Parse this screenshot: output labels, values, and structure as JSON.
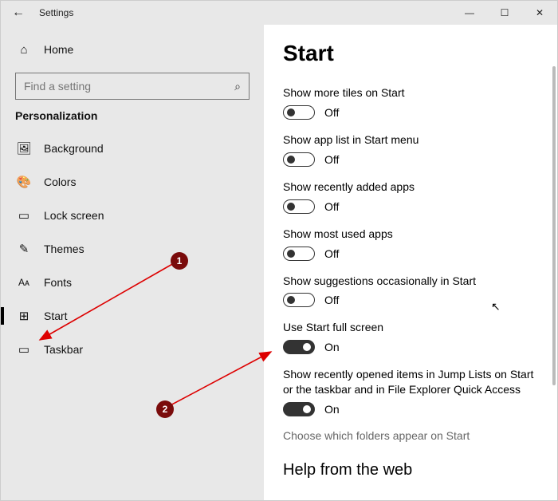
{
  "titlebar": {
    "title": "Settings"
  },
  "sidebar": {
    "home": "Home",
    "search_placeholder": "Find a setting",
    "category": "Personalization",
    "items": [
      {
        "label": "Background"
      },
      {
        "label": "Colors"
      },
      {
        "label": "Lock screen"
      },
      {
        "label": "Themes"
      },
      {
        "label": "Fonts"
      },
      {
        "label": "Start"
      },
      {
        "label": "Taskbar"
      }
    ]
  },
  "main": {
    "heading": "Start",
    "settings": [
      {
        "label": "Show more tiles on Start",
        "state": "Off",
        "on": false
      },
      {
        "label": "Show app list in Start menu",
        "state": "Off",
        "on": false
      },
      {
        "label": "Show recently added apps",
        "state": "Off",
        "on": false
      },
      {
        "label": "Show most used apps",
        "state": "Off",
        "on": false
      },
      {
        "label": "Show suggestions occasionally in Start",
        "state": "Off",
        "on": false
      },
      {
        "label": "Use Start full screen",
        "state": "On",
        "on": true
      },
      {
        "label": "Show recently opened items in Jump Lists on Start or the taskbar and in File Explorer Quick Access",
        "state": "On",
        "on": true
      }
    ],
    "link": "Choose which folders appear on Start",
    "subhead": "Help from the web"
  },
  "annotations": {
    "badge1": "1",
    "badge2": "2"
  }
}
